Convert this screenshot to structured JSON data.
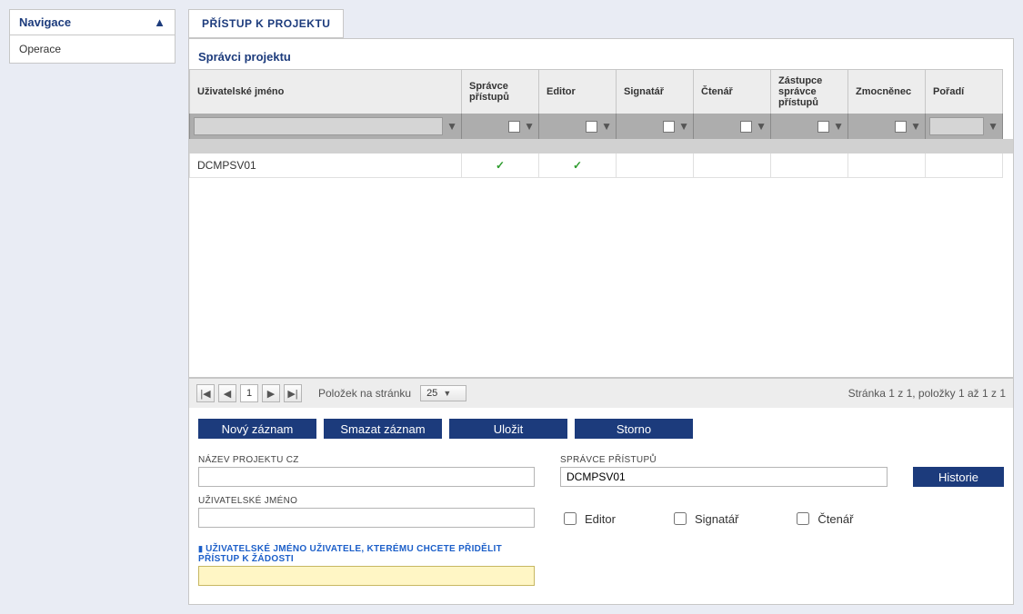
{
  "sidebar": {
    "title": "Navigace",
    "items": [
      {
        "label": "Operace"
      }
    ]
  },
  "tabs": [
    {
      "label": "PŘÍSTUP K PROJEKTU"
    }
  ],
  "section_title": "Správci projektu",
  "grid": {
    "columns": {
      "username": "Uživatelské jméno",
      "access_admin": "Správce přístupů",
      "editor": "Editor",
      "signatory": "Signatář",
      "reader": "Čtenář",
      "deputy_admin": "Zástupce správce přístupů",
      "proxy": "Zmocněnec",
      "order": "Pořadí"
    },
    "rows": [
      {
        "username": "DCMPSV01",
        "access_admin": true,
        "editor": true,
        "signatory": false,
        "reader": false,
        "deputy_admin": false,
        "proxy": false,
        "order": ""
      }
    ]
  },
  "pager": {
    "page": "1",
    "per_page_label": "Položek na stránku",
    "per_page_value": "25",
    "info": "Stránka 1 z 1, položky 1 až 1 z 1"
  },
  "actions": {
    "new": "Nový záznam",
    "delete": "Smazat záznam",
    "save": "Uložit",
    "cancel": "Storno"
  },
  "form": {
    "project_name_cz_label": "NÁZEV PROJEKTU CZ",
    "project_name_cz_value": "",
    "access_admin_label": "SPRÁVCE PŘÍSTUPŮ",
    "access_admin_value": "DCMPSV01",
    "history_button": "Historie",
    "username_label": "UŽIVATELSKÉ JMÉNO",
    "username_value": "",
    "editor_cb": "Editor",
    "signatory_cb": "Signatář",
    "reader_cb": "Čtenář",
    "assign_user_label": "UŽIVATELSKÉ JMÉNO UŽIVATELE, KTERÉMU CHCETE PŘIDĚLIT PŘÍSTUP K ŽÁDOSTI",
    "assign_user_value": ""
  }
}
